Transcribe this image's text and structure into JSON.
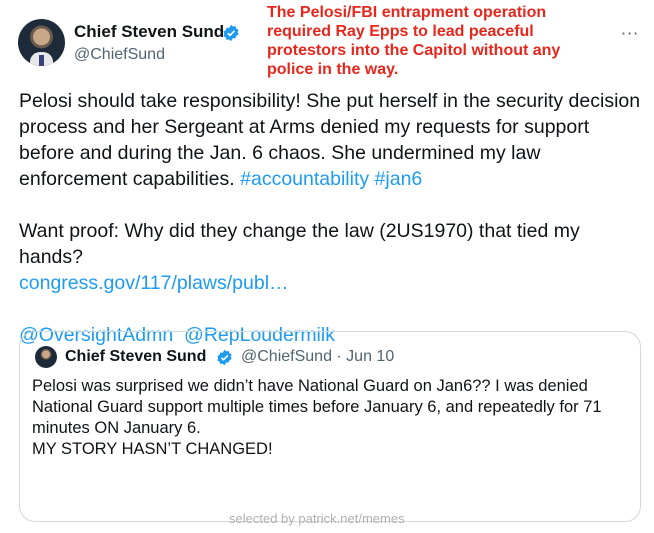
{
  "tweet": {
    "author_name": "Chief Steven Sund",
    "handle": "@ChiefSund",
    "verified_icon": "verified-badge-icon",
    "more_label": "···",
    "body": {
      "p1_text": "Pelosi should take responsibility! She put herself in the security decision process and her Sergeant at Arms denied my requests for support before and during the Jan. 6 chaos. She undermined my law enforcement capabilities. ",
      "hashtag1": "#accountability",
      "hashtag2": "#jan6",
      "p2_text": "Want proof: Why did they change the law (2US1970) that tied my hands?",
      "link": "congress.gov/117/plaws/publ…",
      "mention1": "@OversightAdmn",
      "mention2": "@RepLoudermilk"
    }
  },
  "caption": "The Pelosi/FBI entrapment operation required Ray Epps to lead peaceful protestors into the Capitol without any police in the way.",
  "quoted_tweet": {
    "author_name": "Chief Steven Sund",
    "handle_date": "@ChiefSund · Jun 10",
    "lines": [
      "Pelosi was surprised we didn’t have National Guard on Jan6?? I was denied National Guard support multiple times before January 6, and repeatedly for 71 minutes ON January 6.",
      "MY STORY HASN’T CHANGED!"
    ]
  },
  "watermark": "selected by patrick.net/memes",
  "colors": {
    "link": "#1d9bf0",
    "caption": "#e8261c",
    "secondary": "#536471"
  }
}
